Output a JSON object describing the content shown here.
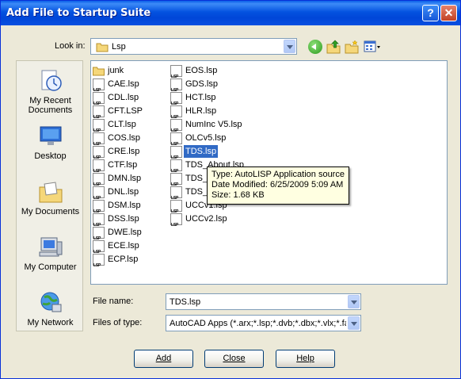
{
  "window": {
    "title": "Add File to Startup Suite"
  },
  "toolbar": {
    "lookin_label": "Look in:",
    "lookin_value": "Lsp",
    "back_icon": "back-arrow-icon",
    "up_icon": "up-folder-icon",
    "newfolder_icon": "new-folder-icon",
    "views_icon": "views-menu-icon"
  },
  "places": [
    {
      "label_line1": "My Recent",
      "label_line2": "Documents",
      "icon": "recent-documents-icon"
    },
    {
      "label_line1": "Desktop",
      "label_line2": "",
      "icon": "desktop-icon"
    },
    {
      "label_line1": "My Documents",
      "label_line2": "",
      "icon": "my-documents-icon"
    },
    {
      "label_line1": "My Computer",
      "label_line2": "",
      "icon": "my-computer-icon"
    },
    {
      "label_line1": "My Network",
      "label_line2": "",
      "icon": "my-network-icon"
    }
  ],
  "files": {
    "column1": [
      "junk",
      "CAE.lsp",
      "CDL.lsp",
      "CFT.LSP",
      "CLT.lsp",
      "COS.lsp",
      "CRE.lsp",
      "CTF.lsp",
      "DMN.lsp",
      "DNL.lsp",
      "DSM.lsp",
      "DSS.lsp",
      "DWE.lsp",
      "ECE.lsp",
      "ECP.lsp"
    ],
    "column2": [
      "EOS.lsp",
      "GDS.lsp",
      "HCT.lsp",
      "HLR.lsp",
      "NumInc V5.lsp",
      "OLCv5.lsp",
      "TDS.lsp",
      "TDS_About.lsp",
      "TDS_F",
      "TDS_",
      "UCCv1.lsp",
      "UCCv2.lsp"
    ],
    "selected": "TDS.lsp"
  },
  "tooltip": {
    "type": "Type: AutoLISP Application source",
    "modified": "Date Modified: 6/25/2009 5:09 AM",
    "size": "Size: 1.68 KB"
  },
  "form": {
    "filename_label": "File name:",
    "filename_value": "TDS.lsp",
    "filetype_label": "Files of type:",
    "filetype_value": "AutoCAD Apps (*.arx;*.lsp;*.dvb;*.dbx;*.vlx;*.fas"
  },
  "buttons": {
    "add": "Add",
    "close": "Close",
    "help": "Help"
  },
  "colors": {
    "title_bar": "#0054e3",
    "selection": "#316ac5",
    "tooltip_bg": "#ffffe1",
    "dialog_bg": "#ece9d8"
  }
}
